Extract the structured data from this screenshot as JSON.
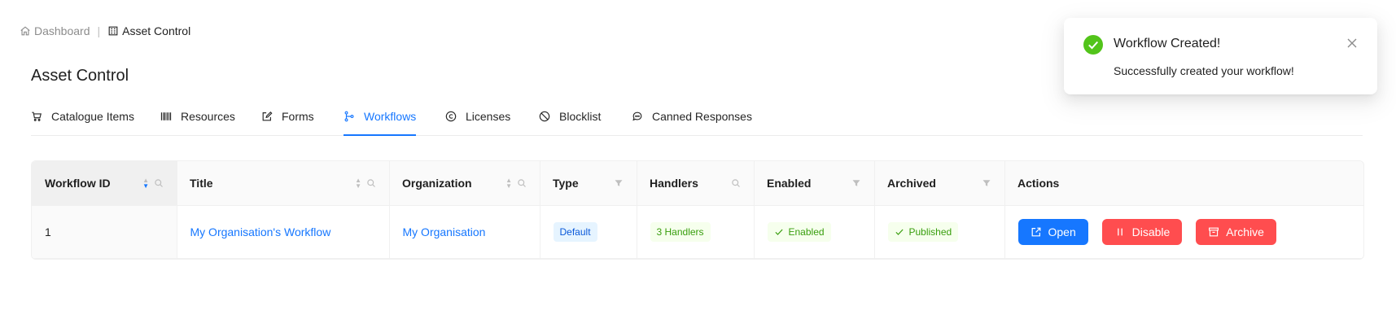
{
  "breadcrumb": {
    "home": "Dashboard",
    "separator": "|",
    "current": "Asset Control"
  },
  "page": {
    "title": "Asset Control"
  },
  "tabs": [
    {
      "label": "Catalogue Items",
      "icon": "cart-icon"
    },
    {
      "label": "Resources",
      "icon": "barcode-icon"
    },
    {
      "label": "Forms",
      "icon": "edit-icon"
    },
    {
      "label": "Workflows",
      "icon": "branches-icon",
      "active": true
    },
    {
      "label": "Licenses",
      "icon": "copyright-icon"
    },
    {
      "label": "Blocklist",
      "icon": "stop-icon"
    },
    {
      "label": "Canned Responses",
      "icon": "message-icon"
    }
  ],
  "table": {
    "columns": [
      "Workflow ID",
      "Title",
      "Organization",
      "Type",
      "Handlers",
      "Enabled",
      "Archived",
      "Actions"
    ],
    "rows": [
      {
        "id": "1",
        "title": "My Organisation's Workflow",
        "organization": "My Organisation",
        "type": "Default",
        "handlers": "3 Handlers",
        "enabled": "Enabled",
        "archived": "Published"
      }
    ],
    "actions": {
      "open": "Open",
      "disable": "Disable",
      "archive": "Archive"
    }
  },
  "toast": {
    "title": "Workflow Created!",
    "message": "Successfully created your workflow!"
  },
  "colors": {
    "primary": "#1677ff",
    "danger": "#ff4d4f",
    "success": "#52c41a"
  }
}
